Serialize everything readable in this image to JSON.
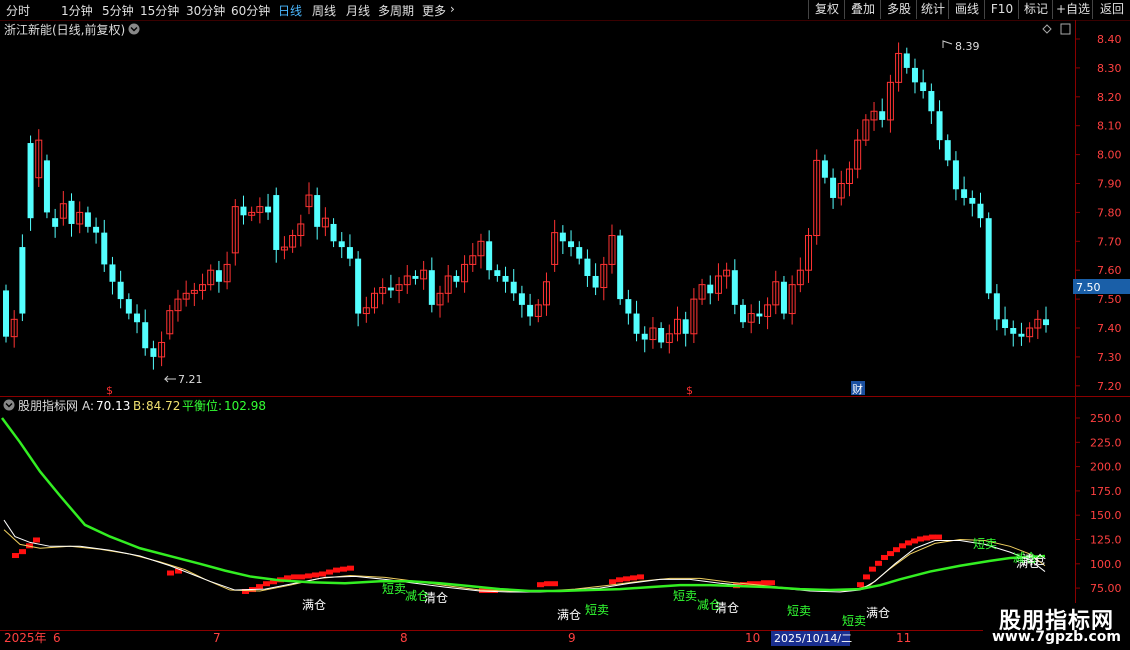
{
  "toolbar": {
    "periods": [
      "分时",
      "1分钟",
      "5分钟",
      "15分钟",
      "30分钟",
      "60分钟",
      "日线",
      "周线",
      "月线",
      "多周期",
      "更多"
    ],
    "active_period": "日线",
    "actions": [
      "复权",
      "叠加",
      "多股",
      "统计",
      "画线",
      "F10",
      "+自选",
      "返回"
    ],
    "extra_action": "标记"
  },
  "main": {
    "title": "浙江新能(日线,前复权)",
    "price_axis": [
      "8.40",
      "8.30",
      "8.20",
      "8.10",
      "8.00",
      "7.90",
      "7.80",
      "7.70",
      "7.60",
      "7.50",
      "7.40",
      "7.30",
      "7.20"
    ],
    "current_price": "7.50",
    "high_label": "8.39",
    "low_label": "7.21",
    "event_markers": [
      "$",
      "$",
      "财"
    ],
    "up_color": "#ff3333",
    "down_color": "#54ffff"
  },
  "indicator": {
    "name": "股朋指标网",
    "a_label": "A:",
    "a_value": "70.13",
    "b_label": "B:",
    "b_value": "84.72",
    "balance_label": "平衡位:",
    "balance_value": "102.98",
    "axis": [
      "250.0",
      "225.0",
      "200.0",
      "175.0",
      "150.0",
      "125.0",
      "100.0",
      "75.00"
    ],
    "signals": [
      "满仓",
      "短卖",
      "减仓",
      "清仓",
      "满仓",
      "短卖",
      "短卖",
      "减仓",
      "清仓",
      "短卖",
      "满仓",
      "短卖",
      "满仓",
      "短卖",
      "减仓",
      "清仓"
    ]
  },
  "date_axis": {
    "labels": [
      "2025年",
      "6",
      "7",
      "8",
      "9",
      "10",
      "2025/10/14/二",
      "11"
    ]
  },
  "watermark": {
    "title": "股朋指标网",
    "url": "www.7gpzb.com"
  }
}
